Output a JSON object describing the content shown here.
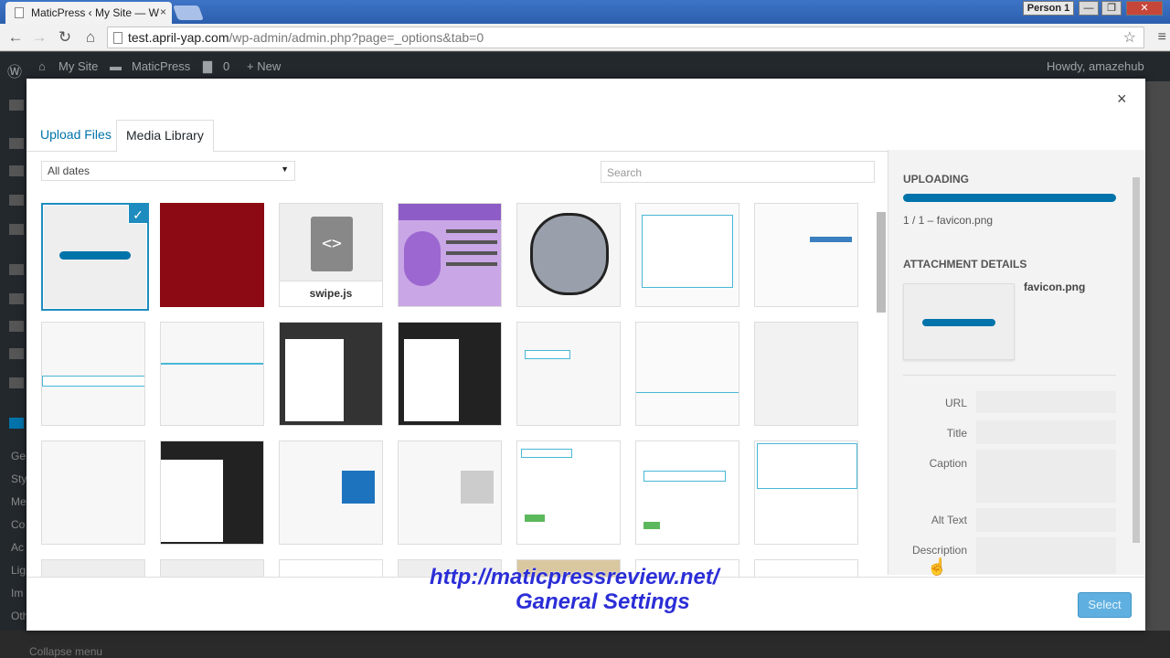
{
  "browser": {
    "tab_title": "MaticPress ‹ My Site — W",
    "tab_close": "×",
    "profile": "Person 1",
    "url_host": "test.april-yap.com",
    "url_path": "/wp-admin/admin.php?page=_options&tab=0"
  },
  "wp_admin_bar": {
    "site": "My Site",
    "plugin": "MaticPress",
    "comments": "0",
    "new": "+ New",
    "howdy": "Howdy, amazehub"
  },
  "sidebar_fragments": [
    "Ge",
    "Sty",
    "Me",
    "Co",
    "Ac",
    "Lig",
    "Im",
    "Oth"
  ],
  "collapse_menu": "Collapse menu",
  "modal": {
    "close": "×",
    "tabs": {
      "upload": "Upload Files",
      "library": "Media Library"
    },
    "filter": "All dates",
    "search_placeholder": "Search",
    "file_name_swipe": "swipe.js",
    "uploading_heading": "Uploading",
    "upload_status": "1 / 1  –  favicon.png",
    "upload_progress": 1.0,
    "attachment_heading": "Attachment Details",
    "attachment_name": "favicon.png",
    "fields": {
      "url": "URL",
      "title": "Title",
      "caption": "Caption",
      "alt": "Alt Text",
      "description": "Description"
    },
    "select_button": "Select"
  },
  "overlay": {
    "line1": "http://maticpressreview.net/",
    "line2": "Ganeral Settings"
  },
  "colors": {
    "accent": "#0073aa",
    "select_button": "#5fb0e0",
    "overlay_text": "#2b2ed6",
    "thumb_red": "#8b0a14"
  }
}
